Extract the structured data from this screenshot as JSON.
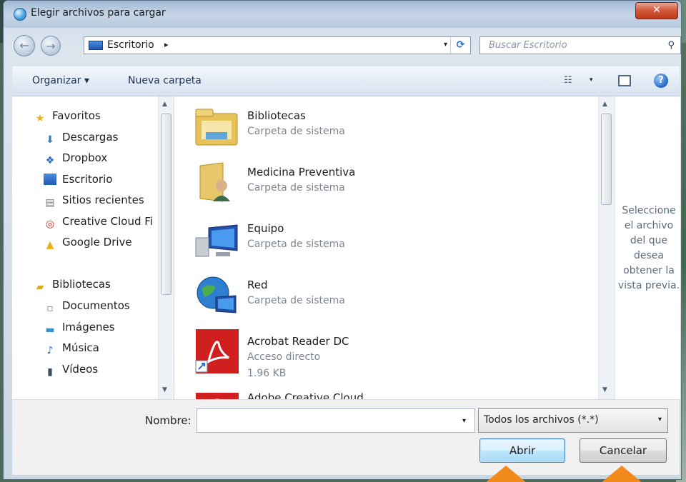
{
  "window": {
    "title": "Elegir archivos para cargar",
    "close_label": "✕"
  },
  "navbar": {
    "back_label": "←",
    "forward_label": "→",
    "address": "Escritorio",
    "address_chevron": "▸",
    "dropdown_arrow": "▾",
    "refresh_label": "⟳",
    "search_placeholder": "Buscar Escritorio"
  },
  "toolbar": {
    "organize_label": "Organizar ▾",
    "new_folder_label": "Nueva carpeta",
    "views_icon_label": "☷",
    "views_drop": "▾",
    "help_label": "?"
  },
  "nav_pane": {
    "favorites_header": "Favoritos",
    "favorites": [
      {
        "label": "Descargas",
        "icon": "downloads-icon"
      },
      {
        "label": "Dropbox",
        "icon": "dropbox-icon"
      },
      {
        "label": "Escritorio",
        "icon": "desktop-icon"
      },
      {
        "label": "Sitios recientes",
        "icon": "recent-places-icon"
      },
      {
        "label": "Creative Cloud Fi",
        "icon": "creative-cloud-icon"
      },
      {
        "label": "Google Drive",
        "icon": "google-drive-icon"
      }
    ],
    "libraries_header": "Bibliotecas",
    "libraries": [
      {
        "label": "Documentos",
        "icon": "documents-icon"
      },
      {
        "label": "Imágenes",
        "icon": "pictures-icon"
      },
      {
        "label": "Música",
        "icon": "music-icon"
      },
      {
        "label": "Vídeos",
        "icon": "videos-icon"
      }
    ]
  },
  "files": [
    {
      "name": "Bibliotecas",
      "type": "Carpeta de sistema",
      "icon": "libraries-folder-icon"
    },
    {
      "name": "Medicina Preventiva",
      "type": "Carpeta de sistema",
      "icon": "user-folder-icon"
    },
    {
      "name": "Equipo",
      "type": "Carpeta de sistema",
      "icon": "computer-icon"
    },
    {
      "name": "Red",
      "type": "Carpeta de sistema",
      "icon": "network-icon"
    },
    {
      "name": "Acrobat Reader DC",
      "type": "Acceso directo",
      "size": "1.96 KB",
      "icon": "acrobat-icon"
    },
    {
      "name": "Adobe Creative Cloud",
      "type": "",
      "icon": "creative-cloud-app-icon"
    }
  ],
  "preview_pane": {
    "message": "Seleccione el archivo del que desea obtener la vista previa."
  },
  "bottom": {
    "name_label": "Nombre:",
    "name_value": "",
    "file_type": "Todos los archivos (*.*)",
    "open_button": "Abrir",
    "cancel_button": "Cancelar"
  },
  "colors": {
    "accent_arrow": "#f28a1b",
    "selection_blue": "#3c7fb1",
    "close_red": "#c0391b"
  }
}
